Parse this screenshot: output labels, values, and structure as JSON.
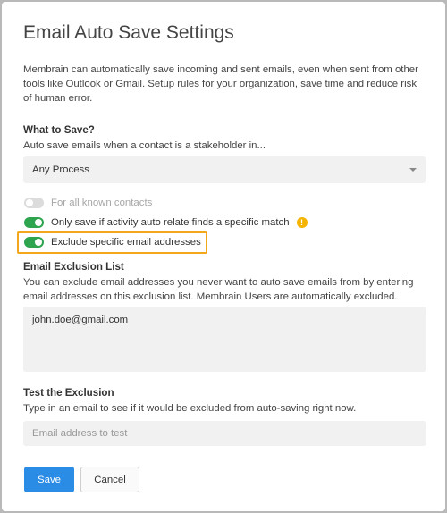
{
  "dialog": {
    "title": "Email Auto Save Settings",
    "intro": "Membrain can automatically save incoming and sent emails, even when sent from other tools like Outlook or Gmail. Setup rules for your organization, save time and reduce risk of human error."
  },
  "what_to_save": {
    "title": "What to Save?",
    "help": "Auto save emails when a contact is a stakeholder in...",
    "process_select": {
      "value": "Any Process"
    }
  },
  "options": [
    {
      "label": "For all known contacts",
      "state": "off",
      "disabled": true
    },
    {
      "label": "Only save if activity auto relate finds a specific match",
      "state": "on",
      "warning_icon": "warning-icon"
    },
    {
      "label": "Exclude specific email addresses",
      "state": "on",
      "highlighted": true
    }
  ],
  "exclusion_list": {
    "title": "Email Exclusion List",
    "help": "You can exclude email addresses you never want to auto save emails from by entering email addresses on this exclusion list. Membrain Users are automatically excluded.",
    "value": "john.doe@gmail.com"
  },
  "test": {
    "title": "Test the Exclusion",
    "help": "Type in an email to see if it would be excluded from auto-saving right now.",
    "placeholder": "Email address to test"
  },
  "buttons": {
    "save": "Save",
    "cancel": "Cancel"
  },
  "colors": {
    "toggle_on": "#2ea44f",
    "primary_button": "#2b8ce6",
    "highlight": "#f3a81b",
    "warning": "#f4b400"
  }
}
